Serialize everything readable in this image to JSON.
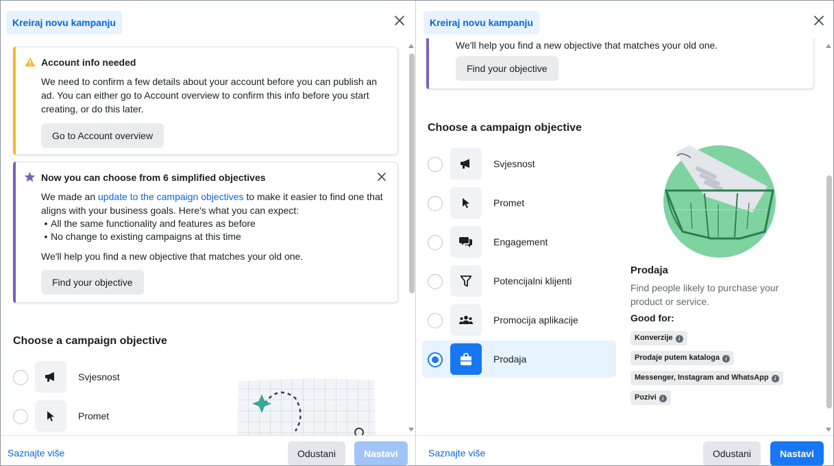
{
  "left": {
    "header_title": "Kreiraj novu kampanju",
    "account_card": {
      "title": "Account info needed",
      "text": "We need to confirm a few details about your account before you can publish an ad. You can either go to Account overview to confirm this info before you start creating, or do this later.",
      "button": "Go to Account overview"
    },
    "objectives_card": {
      "title": "Now you can choose from 6 simplified objectives",
      "text_before_link": "We made an ",
      "link": "update to the campaign objectives",
      "text_after_link": " to make it easier to find one that aligns with your business goals. Here's what you can expect:",
      "bullets": [
        "All the same functionality and features as before",
        "No change to existing campaigns at this time"
      ],
      "note": "We'll help you find a new objective that matches your old one.",
      "button": "Find your objective"
    },
    "section_title": "Choose a campaign objective",
    "options": [
      "Svjesnost",
      "Promet"
    ],
    "footer": {
      "learn_more": "Saznajte više",
      "cancel": "Odustani",
      "continue": "Nastavi"
    }
  },
  "right": {
    "header_title": "Kreiraj novu kampanju",
    "card": {
      "note": "We'll help you find a new objective that matches your old one.",
      "button": "Find your objective"
    },
    "section_title": "Choose a campaign objective",
    "options": [
      {
        "label": "Svjesnost",
        "icon": "megaphone-icon",
        "selected": false
      },
      {
        "label": "Promet",
        "icon": "cursor-icon",
        "selected": false
      },
      {
        "label": "Engagement",
        "icon": "chat-bubbles-icon",
        "selected": false
      },
      {
        "label": "Potencijalni klijenti",
        "icon": "filter-icon",
        "selected": false
      },
      {
        "label": "Promocija aplikacije",
        "icon": "people-icon",
        "selected": false
      },
      {
        "label": "Prodaja",
        "icon": "shopping-bag-icon",
        "selected": true
      }
    ],
    "detail": {
      "title": "Prodaja",
      "description": "Find people likely to purchase your product or service.",
      "good_for_label": "Good for:",
      "tags": [
        "Konverzije",
        "Prodaje putem kataloga",
        "Messenger, Instagram and WhatsApp",
        "Pozivi"
      ]
    },
    "footer": {
      "learn_more": "Saznajte više",
      "cancel": "Odustani",
      "continue": "Nastavi"
    }
  },
  "colors": {
    "primary": "#1877f2",
    "link": "#0a66d6",
    "warning": "#f7b928",
    "purple": "#7b5fc0",
    "illustration_green": "#7fd3a1"
  }
}
